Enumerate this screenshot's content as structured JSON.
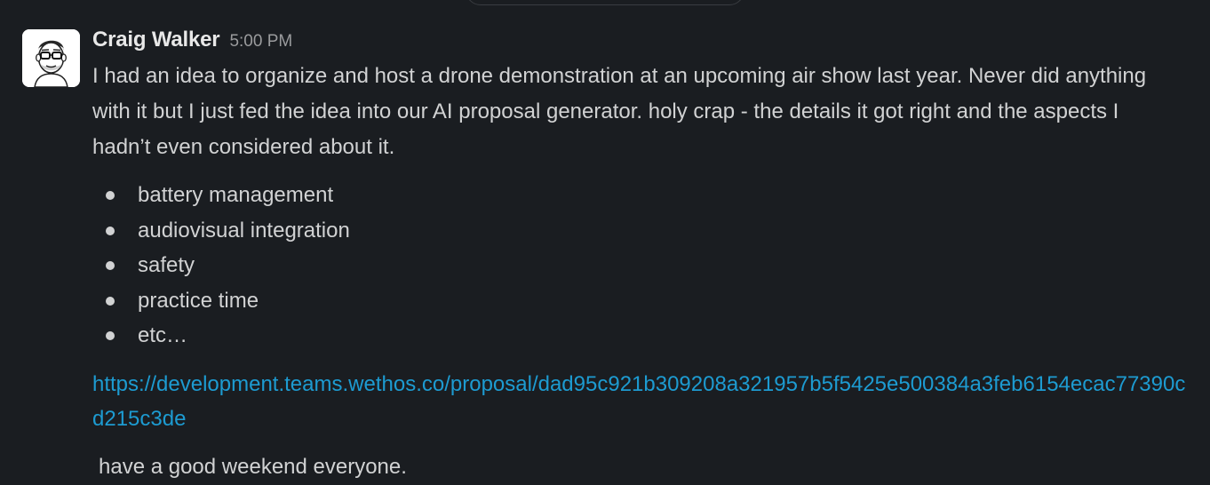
{
  "message": {
    "author": "Craig Walker",
    "timestamp": "5:00 PM",
    "text": "I had an idea to organize and host a drone demonstration at an upcoming air show last year. Never did anything with it but I just fed the idea into our AI proposal generator. holy crap - the details it got right and the aspects I hadn’t even considered about it.",
    "bullets": [
      "battery management",
      "audiovisual integration",
      "safety",
      "practice time",
      "etc…"
    ],
    "link": "https://development.teams.wethos.co/proposal/dad95c921b309208a321957b5f5425e500384a3feb6154ecac77390cd215c3de",
    "closing": "have a good weekend everyone."
  },
  "colors": {
    "background": "#1a1d21",
    "text": "#d1d2d3",
    "link": "#1d9bd1",
    "timestamp": "#9a9b9d"
  }
}
